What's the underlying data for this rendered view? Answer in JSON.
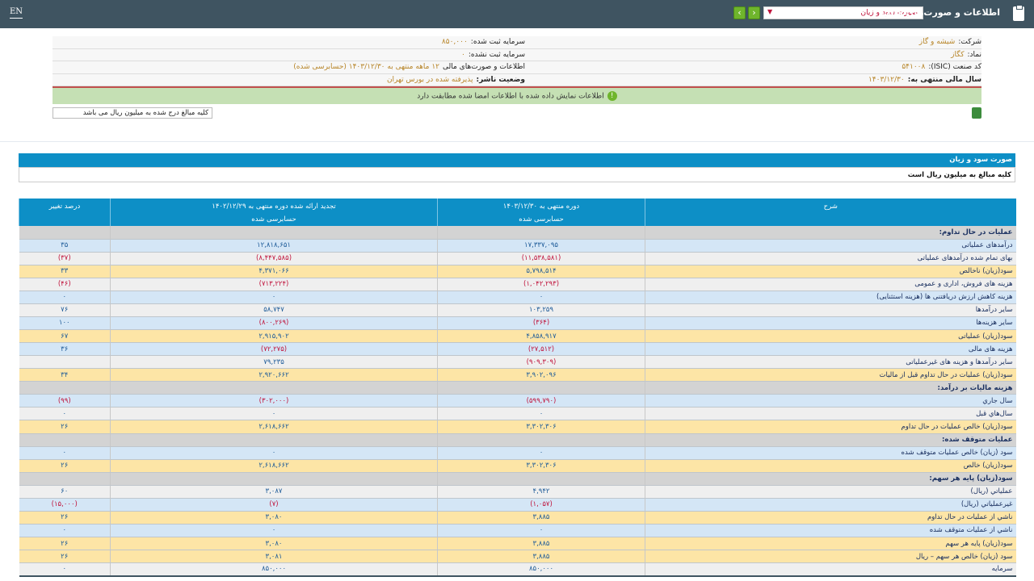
{
  "topbar": {
    "lang": "EN",
    "title": "اطلاعات و صورت‌های مالی",
    "report_select": "صورت سود و زیان",
    "prev": "‹",
    "next": "›"
  },
  "info": {
    "company_label": "شرکت:",
    "company": "شیشه و گاز",
    "symbol_label": "نماد:",
    "symbol": "کگاز",
    "isic_label": "کد صنعت (ISIC):",
    "isic": "۵۴۱۰۰۸",
    "fy_label": "سال مالی منتهی به:",
    "fy": "۱۴۰۳/۱۲/۳۰",
    "cap_reg_label": "سرمایه ثبت شده:",
    "cap_reg": "۸۵۰,۰۰۰",
    "cap_unreg_label": "سرمایه ثبت نشده:",
    "cap_unreg": "۰",
    "statement_label": "اطلاعات و صورت‌های مالی",
    "statement": "۱۲ ماهه منتهی به ۱۴۰۳/۱۲/۳۰ (حسابرسی شده)",
    "status_label": "وضعیت ناشر:",
    "status": "پذیرفته شده در بورس تهران"
  },
  "verified_msg": "اطلاعات نمایش داده شده با اطلاعات امضا شده مطابقت دارد",
  "note_input": "کلیه مبالغ درج شده به میلیون ریال می باشد",
  "section_title": "صورت سود و زیان",
  "unit_note": "کلیه مبالغ به میلیون ریال است",
  "columns": {
    "desc": "شرح",
    "cur1": "دوره منتهی به ۱۴۰۳/۱۲/۳۰",
    "cur2": "حسابرسی شده",
    "prev1": "تجدید ارائه شده دوره منتهی به ۱۴۰۲/۱۲/۲۹",
    "prev2": "حسابرسی شده",
    "pct": "درصد تغییر"
  },
  "rows": [
    {
      "t": "s",
      "d": "عملیات در حال تداوم:",
      "c": "",
      "p": "",
      "x": ""
    },
    {
      "t": "b",
      "d": "درآمدهای عملیاتی",
      "c": "۱۷,۳۳۷,۰۹۵",
      "p": "۱۲,۸۱۸,۶۵۱",
      "x": "۳۵"
    },
    {
      "t": "l",
      "d": "بهای تمام شده درآمدهای عملیاتی",
      "c": "(۱۱,۵۳۸,۵۸۱)",
      "p": "(۸,۴۴۷,۵۸۵)",
      "x": "(۳۷)"
    },
    {
      "t": "y",
      "d": "سود(زیان) ناخالص",
      "c": "۵,۷۹۸,۵۱۴",
      "p": "۴,۳۷۱,۰۶۶",
      "x": "۳۳"
    },
    {
      "t": "l",
      "d": "هزینه های فروش، اداری و عمومی",
      "c": "(۱,۰۴۲,۲۹۳)",
      "p": "(۷۱۳,۲۲۴)",
      "x": "(۴۶)"
    },
    {
      "t": "b",
      "d": "هزینه کاهش ارزش دریافتنی ها (هزینه استثنایی)",
      "c": "۰",
      "p": "۰",
      "x": "۰"
    },
    {
      "t": "l",
      "d": "سایر درآمدها",
      "c": "۱۰۳,۲۵۹",
      "p": "۵۸,۷۴۷",
      "x": "۷۶"
    },
    {
      "t": "b",
      "d": "سایر هزینه‌ها",
      "c": "(۳۶۴)",
      "p": "(۸۰۰,۲۶۹)",
      "x": "۱۰۰"
    },
    {
      "t": "y",
      "d": "سود(زیان) عملیاتی",
      "c": "۴,۸۵۸,۹۱۷",
      "p": "۲,۹۱۵,۹۰۲",
      "x": "۶۷"
    },
    {
      "t": "b",
      "d": "هزینه های مالی",
      "c": "(۲۷,۵۱۲)",
      "p": "(۷۲,۲۷۵)",
      "x": "۳۶"
    },
    {
      "t": "l",
      "d": "سایر درآمدها و هزینه های غیرعملیاتی",
      "c": "(۹۰۹,۳۰۹)",
      "p": "۷۹,۲۳۵",
      "x": ""
    },
    {
      "t": "y",
      "d": "سود(زیان) عملیات در حال تداوم قبل از مالیات",
      "c": "۳,۹۰۲,۰۹۶",
      "p": "۲,۹۲۰,۶۶۲",
      "x": "۳۴"
    },
    {
      "t": "s",
      "d": "هزینه مالیات بر درآمد:",
      "c": "",
      "p": "",
      "x": ""
    },
    {
      "t": "b",
      "d": "سال جاري",
      "c": "(۵۹۹,۷۹۰)",
      "p": "(۳۰۲,۰۰۰)",
      "x": "(۹۹)"
    },
    {
      "t": "l",
      "d": "سال‌هاي قبل",
      "c": "۰",
      "p": "۰",
      "x": "۰"
    },
    {
      "t": "y",
      "d": "سود(زیان) خالص عملیات در حال تداوم",
      "c": "۳,۳۰۲,۳۰۶",
      "p": "۲,۶۱۸,۶۶۲",
      "x": "۲۶"
    },
    {
      "t": "s",
      "d": "عملیات متوقف شده:",
      "c": "",
      "p": "",
      "x": ""
    },
    {
      "t": "b",
      "d": "سود (زیان) خالص عملیات متوقف شده",
      "c": "۰",
      "p": "۰",
      "x": "۰"
    },
    {
      "t": "y",
      "d": "سود(زیان) خالص",
      "c": "۳,۳۰۲,۳۰۶",
      "p": "۲,۶۱۸,۶۶۲",
      "x": "۲۶"
    },
    {
      "t": "s",
      "d": "سود(زیان) پایه هر سهم:",
      "c": "",
      "p": "",
      "x": ""
    },
    {
      "t": "l",
      "d": "عملیاتي (ریال)",
      "c": "۴,۹۴۲",
      "p": "۳,۰۸۷",
      "x": "۶۰"
    },
    {
      "t": "b",
      "d": "غیرعملیاتي (ریال)",
      "c": "(۱,۰۵۷)",
      "p": "(۷)",
      "x": "(۱۵,۰۰۰)"
    },
    {
      "t": "y",
      "d": "ناشي از عملیات در حال تداوم",
      "c": "۳,۸۸۵",
      "p": "۳,۰۸۰",
      "x": "۲۶"
    },
    {
      "t": "b",
      "d": "ناشي از عملیات متوقف شده",
      "c": "۰",
      "p": "۰",
      "x": "۰"
    },
    {
      "t": "y",
      "d": "سود(زیان) پایه هر سهم",
      "c": "۳,۸۸۵",
      "p": "۳,۰۸۰",
      "x": "۲۶"
    },
    {
      "t": "y",
      "d": "سود (زیان) خالص هر سهم – ریال",
      "c": "۳,۸۸۵",
      "p": "۳,۰۸۱",
      "x": "۲۶"
    },
    {
      "t": "l",
      "d": "سرمایه",
      "c": "۸۵۰,۰۰۰",
      "p": "۸۵۰,۰۰۰",
      "x": "۰"
    }
  ]
}
